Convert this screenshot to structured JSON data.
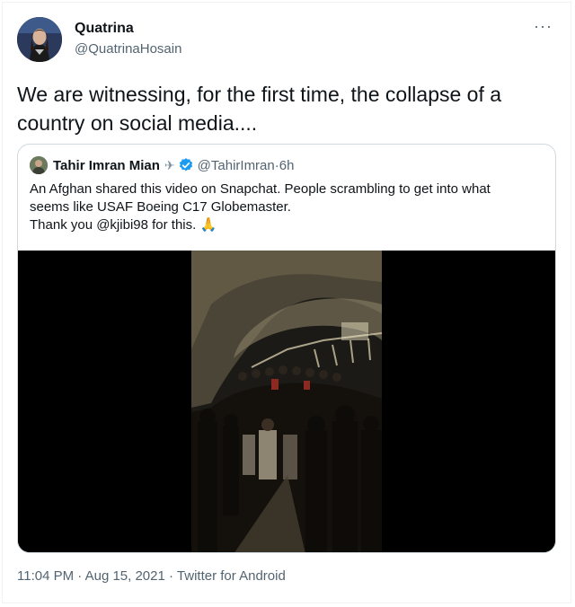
{
  "tweet": {
    "author_name": "Quatrina",
    "author_handle": "@QuatrinaHosain",
    "more_icon": "more-icon",
    "text": "We are witnessing, for the first time, the collapse of a country on social media....",
    "timestamp": "11:04 PM · Aug 15, 2021 · ",
    "source": "Twitter for Android"
  },
  "quote": {
    "author_name": "Tahir Imran Mian",
    "plane_emoji": "✈",
    "author_handle": "@TahirImran",
    "separator": " · ",
    "time": "6h",
    "line1": "An Afghan shared this video on Snapchat. People scrambling to get into what",
    "line2": "seems like USAF Boeing C17 Globemaster.",
    "line3": "Thank you @kjibi98 for this. 🙏"
  },
  "colors": {
    "text": "#0f1419",
    "secondary": "#536471",
    "border": "#cfd9de",
    "verified": "#1d9bf0"
  }
}
